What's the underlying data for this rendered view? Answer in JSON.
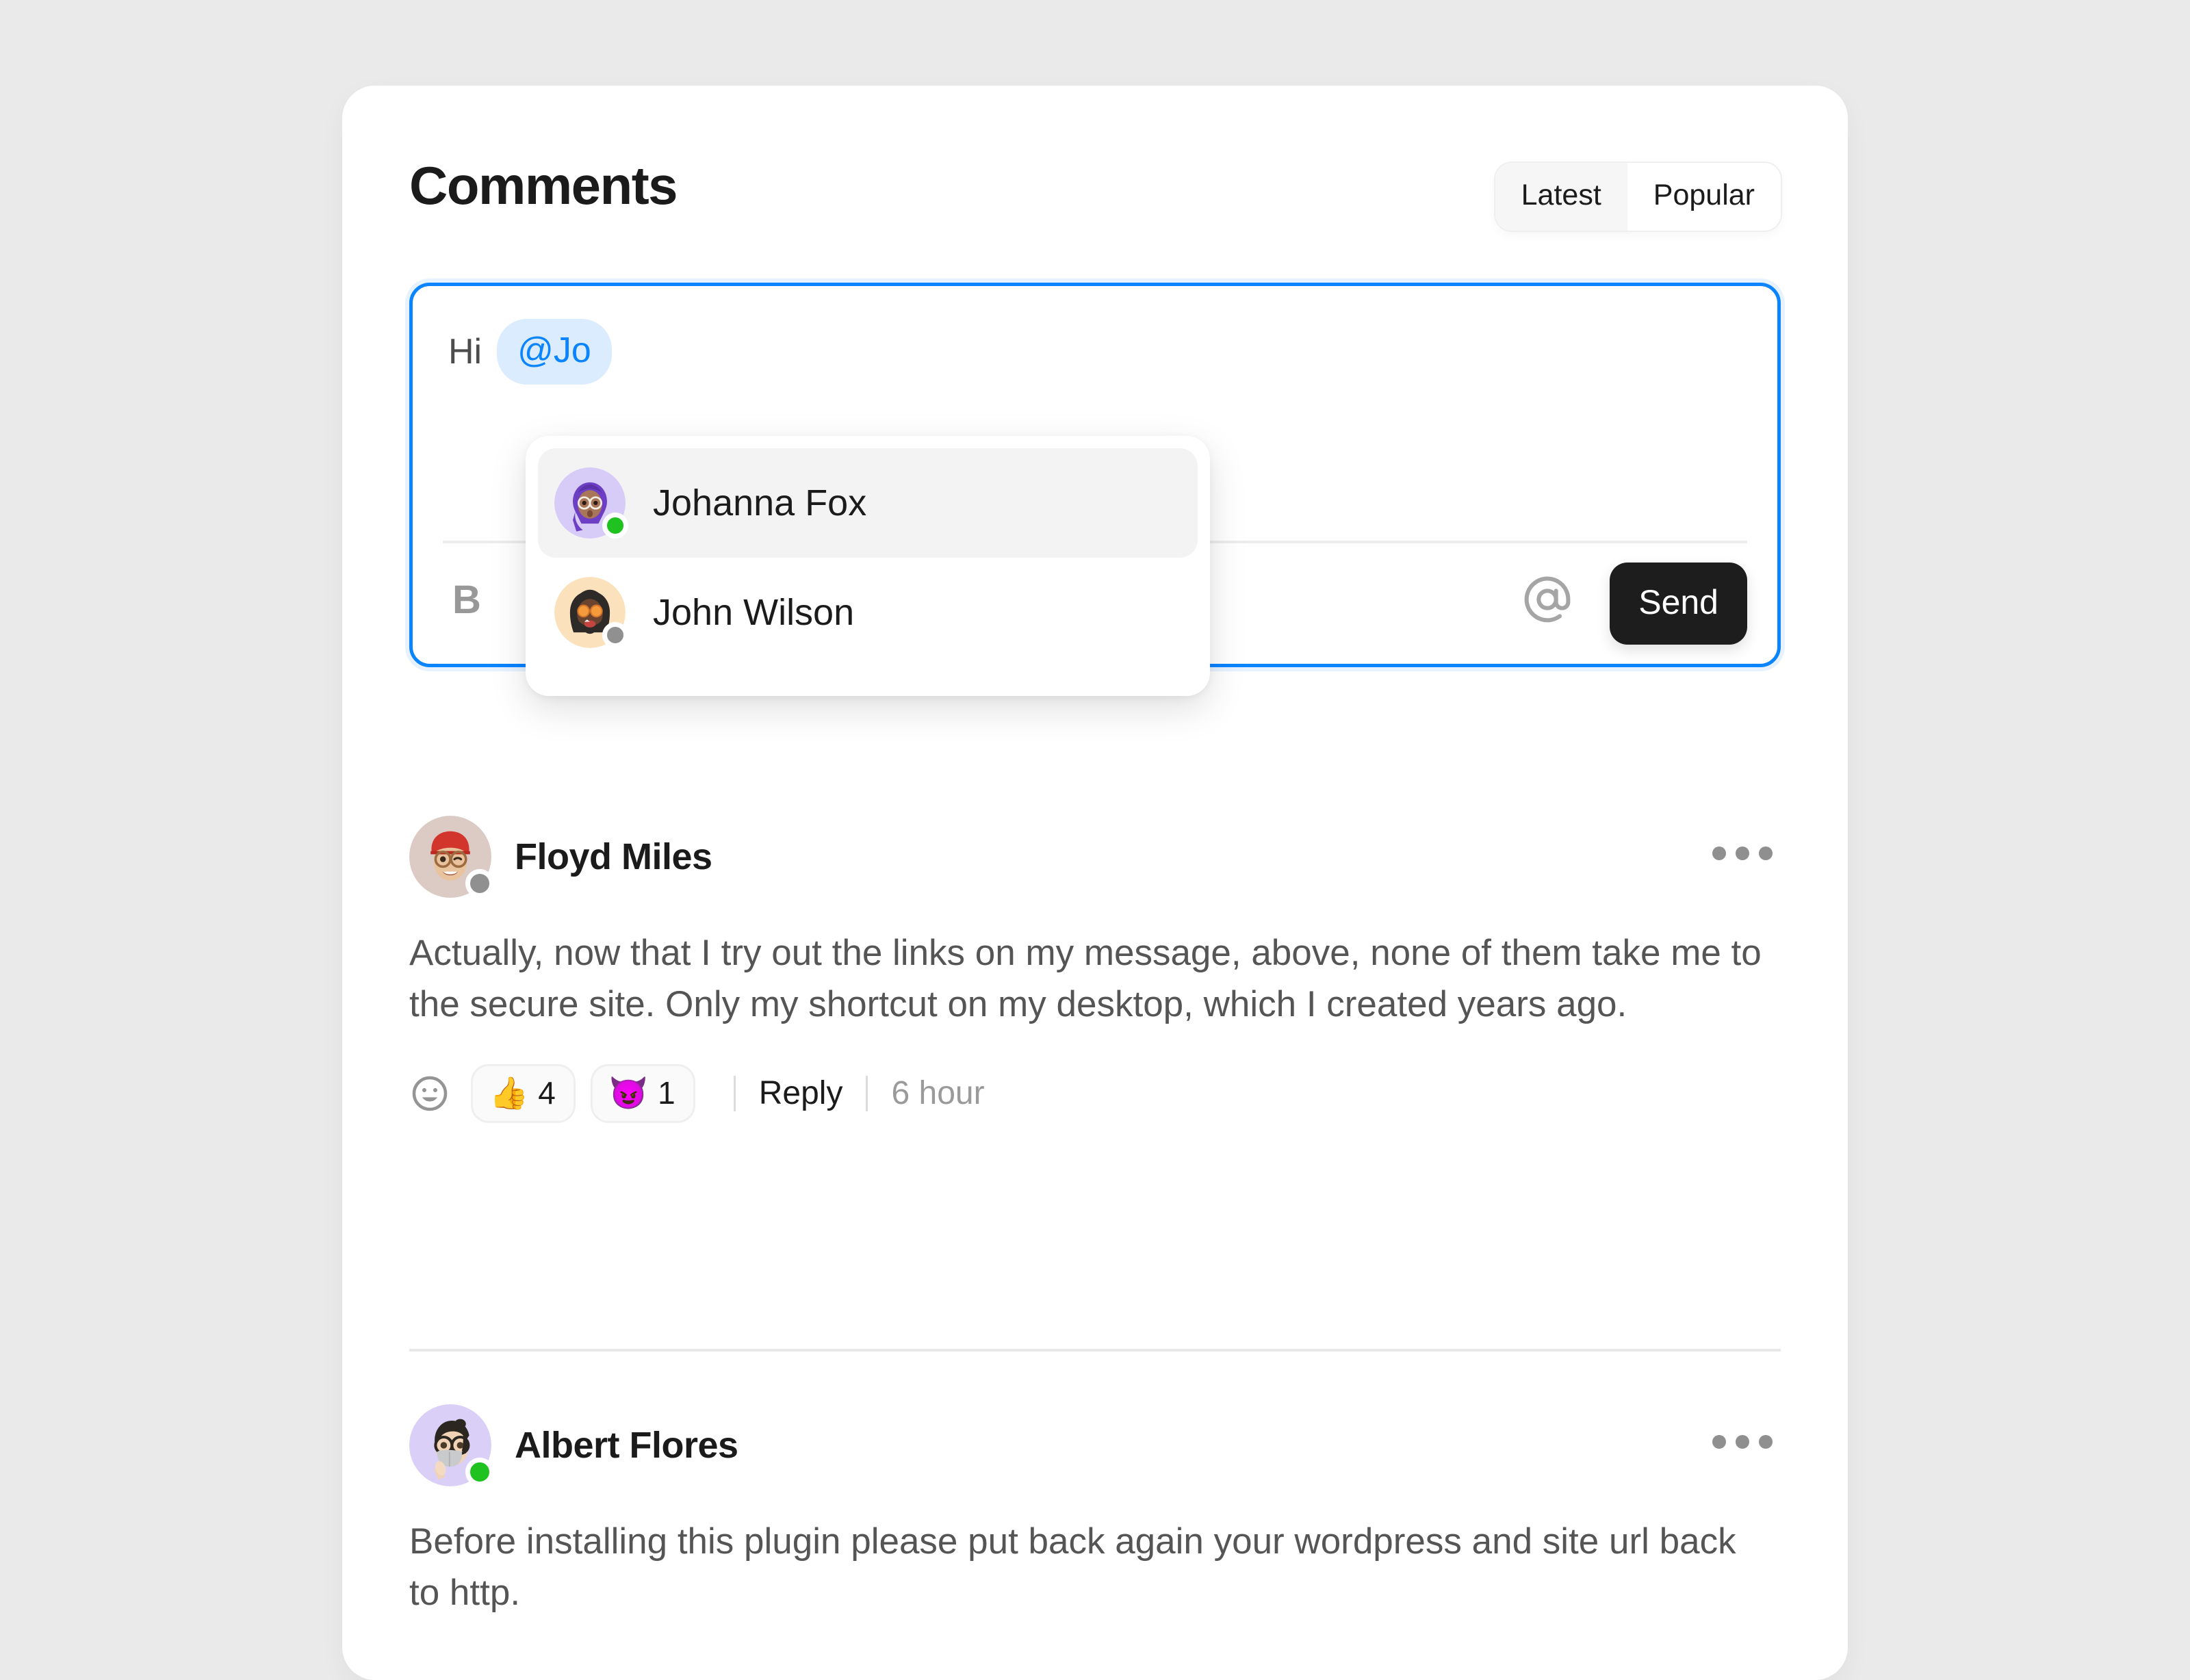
{
  "header": {
    "title": "Comments",
    "sort_options": [
      {
        "label": "Latest",
        "state": "inactive"
      },
      {
        "label": "Popular",
        "state": "active"
      }
    ]
  },
  "composer": {
    "text_prefix": "Hi",
    "mention_chip": "@Jo",
    "bold_icon_label": "B",
    "mention_icon": "at-icon",
    "send_label": "Send"
  },
  "mention_dropdown": {
    "items": [
      {
        "name": "Johanna Fox",
        "status": "online",
        "highlighted": true
      },
      {
        "name": "John Wilson",
        "status": "offline",
        "highlighted": false
      }
    ]
  },
  "comments": [
    {
      "author": "Floyd Miles",
      "status": "offline",
      "body": "Actually, now that I try out the links on my message, above, none of them take me to the secure site. Only my shortcut on my desktop, which I created years ago.",
      "reactions": [
        {
          "emoji": "👍",
          "count": "4"
        },
        {
          "emoji": "😈",
          "count": "1"
        }
      ],
      "reply_label": "Reply",
      "time": "6 hour",
      "more_label": "more-options"
    },
    {
      "author": "Albert Flores",
      "status": "online",
      "body": "Before installing this plugin please put back again your wordpress and site url back to http.",
      "reactions": [],
      "reply_label": "",
      "time": "",
      "more_label": "more-options"
    }
  ],
  "colors": {
    "accent_blue": "#0A84FF",
    "mention_bg": "#DBECFE",
    "send_bg": "#1D1D1D",
    "online": "#1FC21F",
    "offline": "#909090",
    "page_bg": "#EAEAEA",
    "card_bg": "#FFFFFF"
  }
}
